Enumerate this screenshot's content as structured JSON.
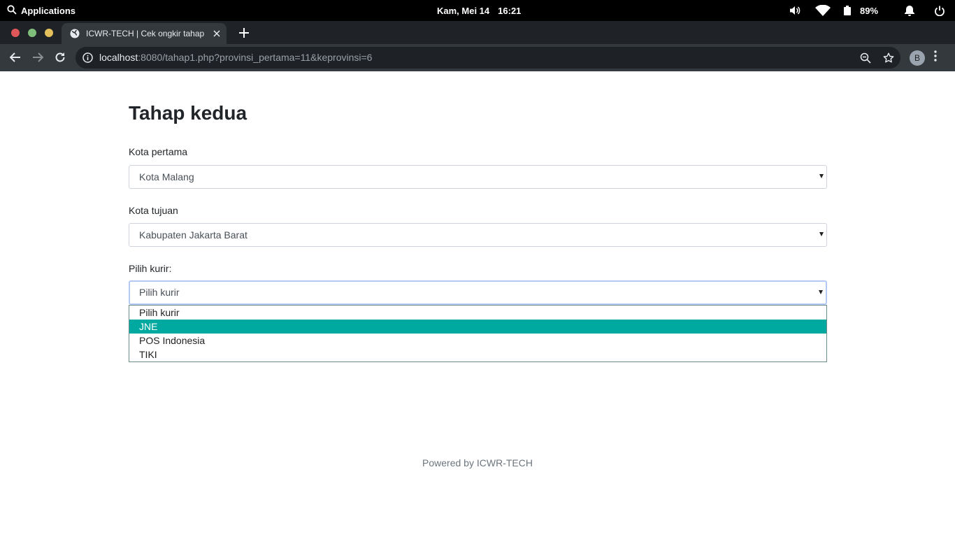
{
  "system": {
    "apps_label": "Applications",
    "date": "Kam, Mei 14",
    "time": "16:21",
    "battery": "89%"
  },
  "browser": {
    "tab_title": "ICWR-TECH | Cek ongkir tahap",
    "url_host": "localhost",
    "url_rest": ":8080/tahap1.php?provinsi_pertama=11&keprovinsi=6",
    "avatar_letter": "B"
  },
  "page": {
    "heading": "Tahap kedua",
    "origin_label": "Kota pertama",
    "origin_value": "Kota Malang",
    "dest_label": "Kota tujuan",
    "dest_value": "Kabupaten Jakarta Barat",
    "courier_label": "Pilih kurir:",
    "courier_value": "Pilih kurir",
    "courier_options": [
      "Pilih kurir",
      "JNE",
      "POS Indonesia",
      "TIKI"
    ],
    "highlighted_option": "JNE",
    "footer": "Powered by ICWR-TECH"
  },
  "colors": {
    "highlight": "#00a99f",
    "focus_ring": "#b5c9f7"
  }
}
